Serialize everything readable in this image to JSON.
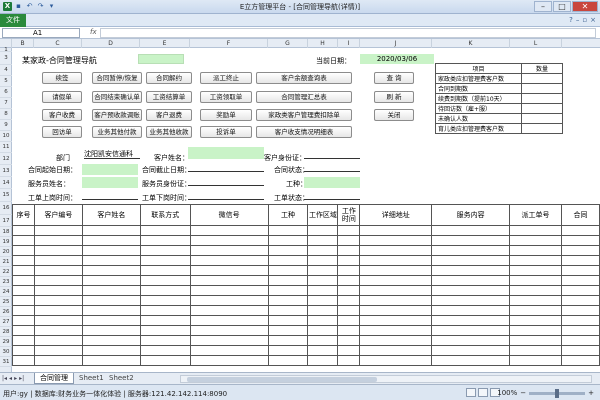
{
  "window": {
    "title": "E立方管理平台 - [合同管理导航(详情)]"
  },
  "ribbon": {
    "file_tab": "文件"
  },
  "formula_bar": {
    "cell_ref": "A1",
    "fx": "fx",
    "value": ""
  },
  "columns": [
    "B",
    "C",
    "D",
    "E",
    "F",
    "G",
    "H",
    "I",
    "J",
    "K",
    "L"
  ],
  "rows": [
    "1",
    "3",
    "4",
    "5",
    "6",
    "7",
    "8",
    "9",
    "10",
    "11",
    "12",
    "13",
    "14",
    "15",
    "16",
    "17",
    "18",
    "19",
    "20",
    "21",
    "22",
    "23",
    "24",
    "25",
    "26",
    "27",
    "28",
    "29",
    "30",
    "31",
    "32"
  ],
  "header": {
    "title": "某家政-合同管理导航",
    "date_label": "当前日期：",
    "date_value": "2020/03/06"
  },
  "buttons": {
    "sign": "续签",
    "pause_resume": "合同暂停/恢复",
    "terminate": "合同解约",
    "dispatch_stop": "派工终止",
    "balance_query": "客户余额查询表",
    "query": "查 询",
    "leave": "请假单",
    "settle_confirm": "合同结束确认单",
    "pay_settle": "工资结算单",
    "pay_leave": "工资领取单",
    "summary": "合同管理汇总表",
    "refresh": "刷 新",
    "customer_pay": "客户收费",
    "advance_adjust": "客户预收款调账",
    "refund": "客户退费",
    "bonus": "奖励单",
    "deduct": "家政类客户管理费扣除单",
    "close": "关闭",
    "return": "回访单",
    "other_pay": "业务其他付款",
    "other_income": "业务其他收款",
    "complaint": "投诉单",
    "fee_detail": "客户收支情况明细表"
  },
  "stats": {
    "header_item": "项目",
    "header_count": "数量",
    "items": [
      {
        "label": "家政类应扣管理费客户数",
        "value": ""
      },
      {
        "label": "合同到期数",
        "value": ""
      },
      {
        "label": "续费到期数（提前10天）",
        "value": ""
      },
      {
        "label": "待回访数（雇+服）",
        "value": ""
      },
      {
        "label": "未确认人数",
        "value": ""
      },
      {
        "label": "育儿类应扣管理费客户数",
        "value": ""
      }
    ]
  },
  "form": {
    "dept_label": "部门",
    "dept_value": "沈阳凯安信通科",
    "customer_name_label": "客户姓名：",
    "customer_id_label": "客户身份证：",
    "start_date_label": "合同起始日期：",
    "end_date_label": "合同截止日期：",
    "status_label": "合同状态：",
    "worker_name_label": "服务员姓名：",
    "worker_id_label": "服务员身份证：",
    "type_label": "工种：",
    "work_up_label": "工单上岗时间：",
    "work_down_label": "工单下岗时间：",
    "work_status_label": "工单状态："
  },
  "table": {
    "headers": [
      "序号",
      "客户编号",
      "客户姓名",
      "联系方式",
      "微信号",
      "工种",
      "工作区域",
      "工作时间",
      "详细地址",
      "服务内容",
      "派工单号",
      "合同"
    ]
  },
  "sheet_tabs": [
    "合同管理",
    "Sheet1",
    "Sheet2"
  ],
  "status_bar": {
    "text": "用户:gy | 数据库:财务业务一体化体验 | 服务器:121.42.142.114:8090",
    "zoom": "100%"
  }
}
